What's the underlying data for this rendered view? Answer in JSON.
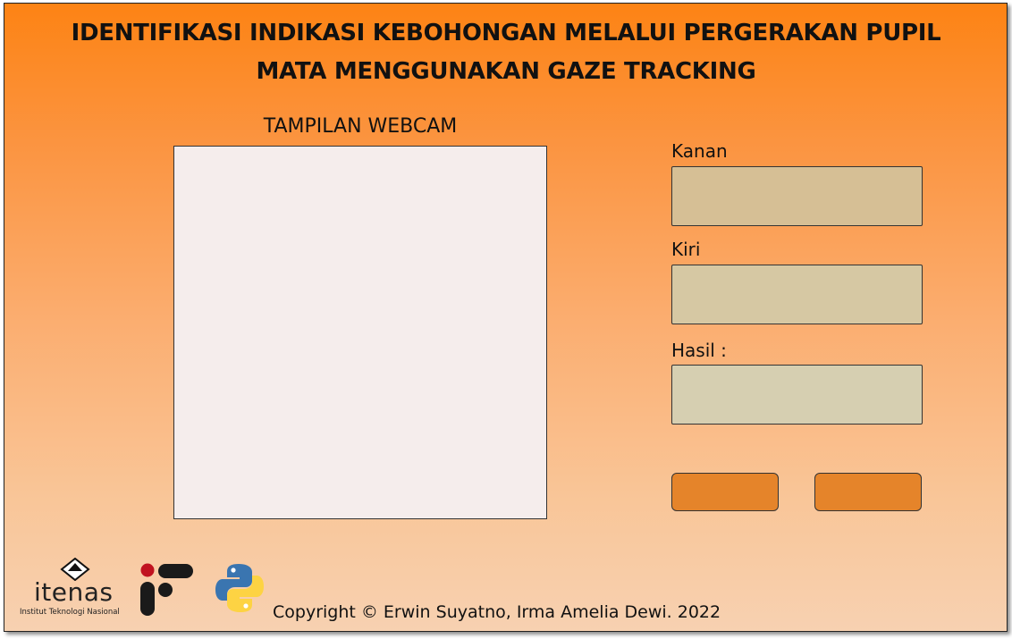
{
  "header": {
    "title_line1": "IDENTIFIKASI INDIKASI KEBOHONGAN MELALUI PERGERAKAN PUPIL",
    "title_line2": "MATA MENGGUNAKAN GAZE TRACKING"
  },
  "webcam": {
    "label": "TAMPILAN WEBCAM"
  },
  "fields": {
    "kanan": {
      "label": "Kanan",
      "value": "",
      "color": "#d6bf95"
    },
    "kiri": {
      "label": "Kiri",
      "value": "",
      "color": "#d6c8a3"
    },
    "hasil": {
      "label": "Hasil :",
      "value": "",
      "color": "#d6cfb1"
    }
  },
  "buttons": {
    "left": {
      "label": "",
      "color": "#e5842a"
    },
    "right": {
      "label": "",
      "color": "#e5842a"
    }
  },
  "footer": {
    "copyright": "Copyright © Erwin Suyatno, Irma Amelia Dewi. 2022",
    "logos": {
      "itenas_name": "itenas",
      "itenas_subtitle": "Institut Teknologi Nasional",
      "if_icon": "informatika-logo",
      "python_icon": "python-logo"
    }
  },
  "colors": {
    "background_top": "#fd8314",
    "background_bottom": "#f7d1b1",
    "webcam_panel": "#f5edec",
    "button": "#e5842a"
  }
}
